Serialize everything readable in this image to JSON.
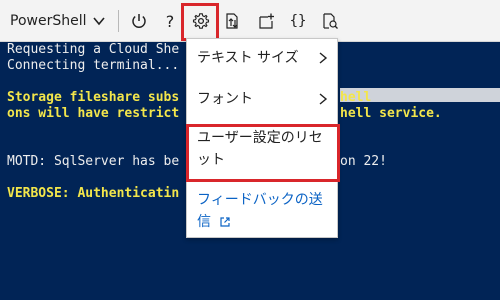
{
  "toolbar": {
    "shell_label": "PowerShell",
    "help_label": "?",
    "braces_label": "{}"
  },
  "terminal": {
    "line1": "Requesting a Cloud She",
    "line2": "Connecting terminal...",
    "line3": "Storage fileshare subs",
    "line3b": "hell",
    "line4": "ons will have restrict",
    "line4b": "hell service.",
    "line5": "MOTD: SqlServer has be",
    "line5b": "on 22!",
    "line6": "VERBOSE: Authenticatin"
  },
  "menu": {
    "items": [
      {
        "label": "テキスト サイズ"
      },
      {
        "label": "フォント"
      },
      {
        "label_line1": "ユーザー設定のリセ",
        "label_line2": "ット"
      },
      {
        "label_line1": "フィードバックの送",
        "label_line2": "信"
      }
    ]
  },
  "colors": {
    "terminal_bg": "#012456",
    "warning_text": "#f3e64b",
    "highlight": "#d9262b",
    "link": "#0b63c5"
  },
  "icons": [
    "chevron-down-icon",
    "power-icon",
    "help-icon",
    "gear-icon",
    "upload-download-icon",
    "new-session-icon",
    "braces-icon",
    "web-preview-icon",
    "chevron-right-icon",
    "external-link-icon"
  ]
}
